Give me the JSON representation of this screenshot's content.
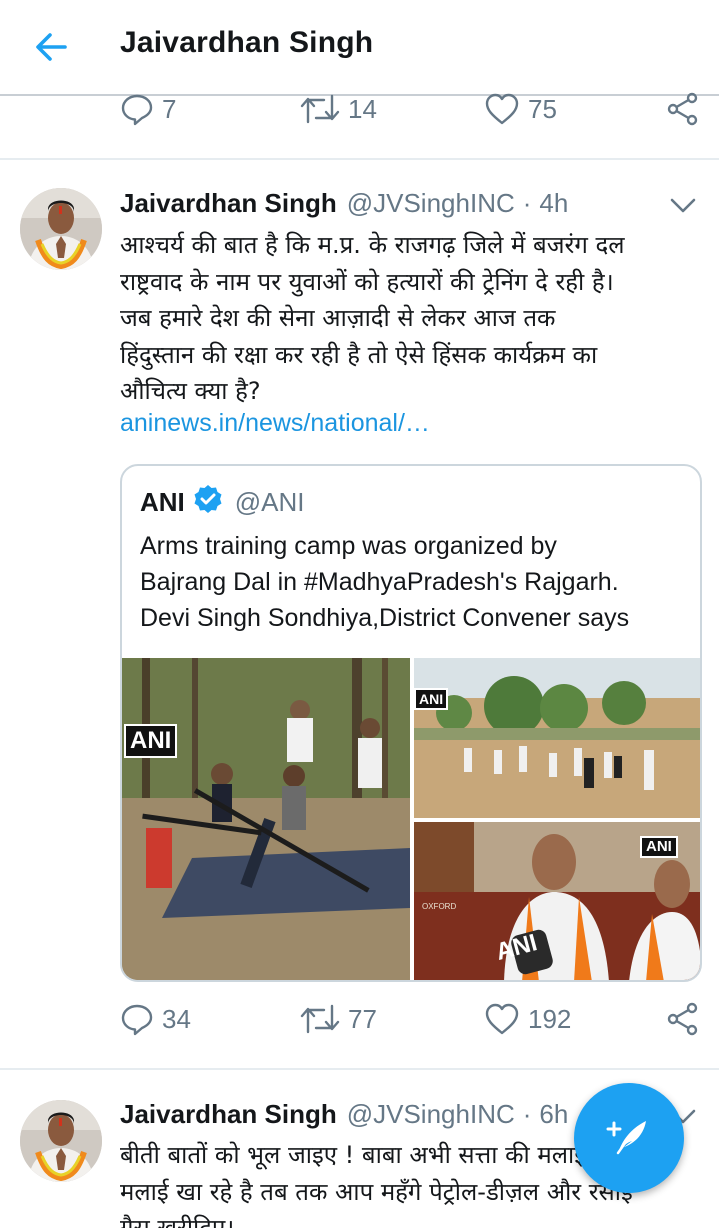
{
  "header": {
    "title": "Jaivardhan Singh"
  },
  "prev_tweet": {
    "replies": "7",
    "retweets": "14",
    "likes": "75"
  },
  "tweet1": {
    "name": "Jaivardhan Singh",
    "handle": "@JVSinghINC",
    "dot": "·",
    "time": "4h",
    "text_lines": [
      "आश्चर्य की बात है कि म.प्र. के राजगढ़ जिले में बजरंग दल",
      "राष्ट्रवाद के नाम पर युवाओं को हत्यारों की ट्रेनिंग दे रही है।",
      "जब हमारे देश की सेना आज़ादी से लेकर आज तक",
      "हिंदुस्तान की रक्षा कर रही है तो ऐसे हिंसक कार्यक्रम का",
      "औचित्य क्या है?"
    ],
    "link": "aninews.in/news/national/…",
    "quote": {
      "name": "ANI",
      "handle": "@ANI",
      "text_lines": [
        "Arms training camp was organized by",
        "Bajrang Dal in #MadhyaPradesh's Rajgarh.",
        "Devi Singh Sondhiya,District Convener says"
      ],
      "media_watermark": "ANI",
      "mic_label": "ANI",
      "sign_text": "OXFORD"
    },
    "replies": "34",
    "retweets": "77",
    "likes": "192"
  },
  "tweet2": {
    "name": "Jaivardhan Singh",
    "handle": "@JVSinghINC",
    "dot": "·",
    "time": "6h",
    "text_lines": [
      "बीती बातों को भूल जाइए ! बाबा अभी सत्ता की मलाई",
      "मलाई खा रहे है तब तक आप महँगे पेट्रोल-डीज़ल और रसोई",
      "गैस खरीदिए।"
    ]
  },
  "colors": {
    "accent": "#1da1f2",
    "link": "#1b95e0",
    "muted": "#657786",
    "text": "#14171a"
  },
  "icons": {
    "back": "arrow-left-icon",
    "reply": "reply-bubble-icon",
    "retweet": "retweet-icon",
    "like": "heart-icon",
    "share": "share-icon",
    "caret": "chevron-down-icon",
    "verified": "verified-badge-icon",
    "compose": "compose-feather-icon"
  }
}
